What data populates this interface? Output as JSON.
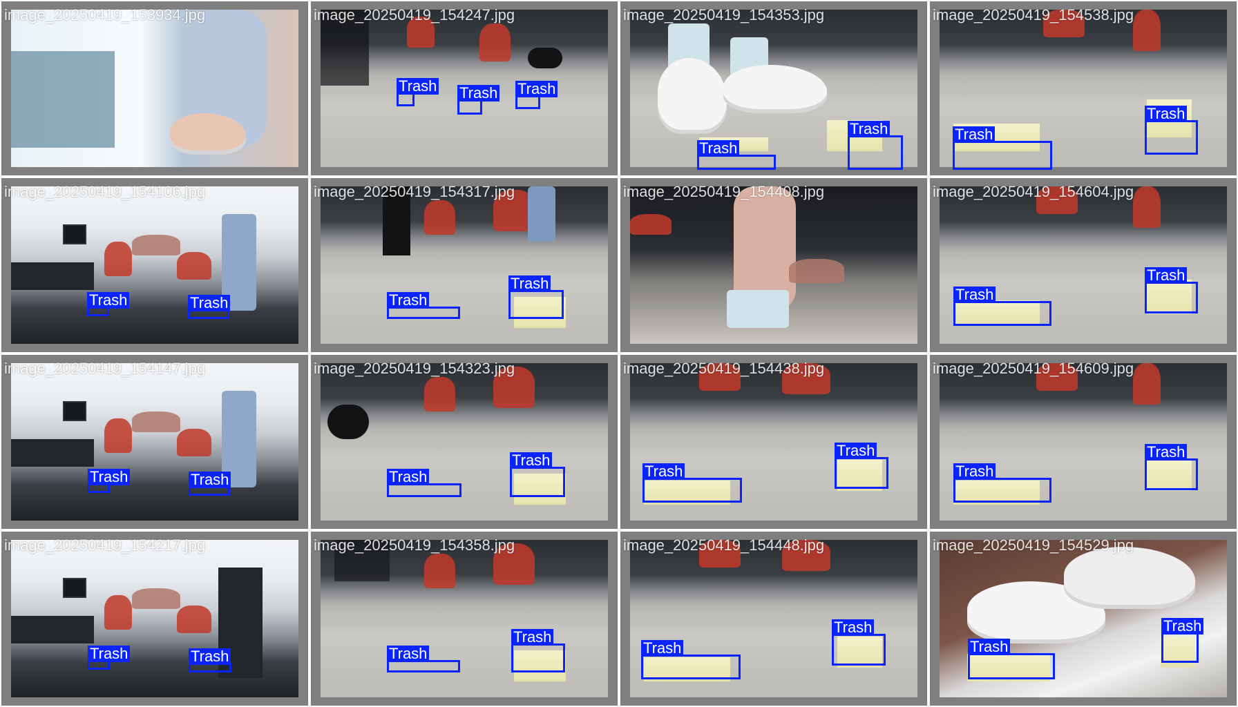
{
  "grid_title": "",
  "colors": {
    "tile_border": "#7f7f7f",
    "detection_box": "#0a24ff",
    "detection_label_text": "#ffffff",
    "filename_text": "#ffffff"
  },
  "tiles": [
    {
      "filename": "image_20250419_153934.jpg",
      "detections": []
    },
    {
      "filename": "image_20250419_154247.jpg",
      "detections": [
        {
          "label": "Trash"
        },
        {
          "label": "Trash"
        },
        {
          "label": "Trash"
        }
      ]
    },
    {
      "filename": "image_20250419_154353.jpg",
      "detections": [
        {
          "label": "Trash"
        },
        {
          "label": "Trash"
        }
      ]
    },
    {
      "filename": "image_20250419_154538.jpg",
      "detections": [
        {
          "label": "Trash"
        },
        {
          "label": "Trash"
        }
      ]
    },
    {
      "filename": "image_20250419_154106.jpg",
      "detections": [
        {
          "label": "Trash"
        },
        {
          "label": "Trash"
        }
      ]
    },
    {
      "filename": "image_20250419_154317.jpg",
      "detections": [
        {
          "label": "Trash"
        },
        {
          "label": "Trash"
        }
      ]
    },
    {
      "filename": "image_20250419_154408.jpg",
      "detections": []
    },
    {
      "filename": "image_20250419_154604.jpg",
      "detections": [
        {
          "label": "Trash"
        },
        {
          "label": "Trash"
        }
      ]
    },
    {
      "filename": "image_20250419_154147.jpg",
      "detections": [
        {
          "label": "Trash"
        },
        {
          "label": "Trash"
        }
      ]
    },
    {
      "filename": "image_20250419_154323.jpg",
      "detections": [
        {
          "label": "Trash"
        },
        {
          "label": "Trash"
        }
      ]
    },
    {
      "filename": "image_20250419_154438.jpg",
      "detections": [
        {
          "label": "Trash"
        },
        {
          "label": "Trash"
        }
      ]
    },
    {
      "filename": "image_20250419_154609.jpg",
      "detections": [
        {
          "label": "Trash"
        },
        {
          "label": "Trash"
        }
      ]
    },
    {
      "filename": "image_20250419_154217.jpg",
      "detections": [
        {
          "label": "Trash"
        },
        {
          "label": "Trash"
        }
      ]
    },
    {
      "filename": "image_20250419_154358.jpg",
      "detections": [
        {
          "label": "Trash"
        },
        {
          "label": "Trash"
        }
      ]
    },
    {
      "filename": "image_20250419_154448.jpg",
      "detections": [
        {
          "label": "Trash"
        },
        {
          "label": "Trash"
        }
      ]
    },
    {
      "filename": "image_20250419_154529.jpg",
      "detections": [
        {
          "label": "Trash"
        },
        {
          "label": "Trash"
        }
      ]
    }
  ]
}
